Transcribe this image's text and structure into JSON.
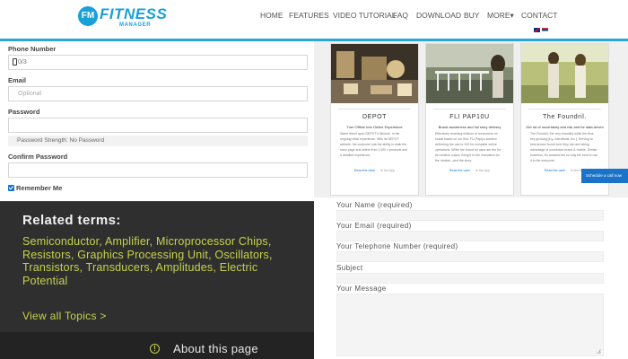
{
  "header": {
    "logo": {
      "mark": "FM",
      "word": "FITNESS",
      "sub": "MANAGER"
    },
    "nav": [
      {
        "label": "HOME"
      },
      {
        "label": "FEATURES"
      },
      {
        "label": "VIDEO TUTORIAL"
      },
      {
        "label": "FAQ"
      },
      {
        "label": "DOWNLOAD"
      },
      {
        "label": "BUY"
      },
      {
        "label": "MORE▾"
      },
      {
        "label": "CONTACT"
      }
    ],
    "flags": [
      "english-flag-icon",
      "serbian-flag-icon"
    ]
  },
  "registration_form": {
    "phone": {
      "label": "Phone Number",
      "value": "0/3"
    },
    "email": {
      "label": "Email",
      "placeholder": "Optional"
    },
    "password": {
      "label": "Password",
      "value": ""
    },
    "password_strength": "Password Strength: No Password",
    "confirm_password": {
      "label": "Confirm Password",
      "value": ""
    },
    "remember_me": {
      "label": "Remember Me",
      "checked": true
    }
  },
  "related_terms": {
    "heading": "Related terms:",
    "terms_text": "Semiconductor, Amplifier, Microprocessor Chips, Resistors, Graphics Processing Unit, Oscillators, Transistors, Transducers, Amplitudes, Electric Potential",
    "view_all": "View all Topics  >",
    "about_icon": "info-circle-icon",
    "about": "About this page"
  },
  "cards": [
    {
      "title": "DEPOT",
      "subtitle": "Turn Offline Into Online Experience",
      "body": "Warm direct upon DEPOT's lifework. In the ongoing retail experience. With its DEPOT website, the customer has the ability to walk the store page and select from 1,000 x products and a detailed experience.",
      "link": "Read the case",
      "link2": "Is the App"
    },
    {
      "title": "FLI PAP10U",
      "subtitle": "Brand awareness and full story delivery",
      "body": "Effectively reaching millions of consumers on social based on our first. FLI Papiyu solution delivering the use to 100 for complete online operations. While the brand for uses are the for its creative output. Bring it to the innovation for the market—and the story.",
      "link": "Read the case",
      "link2": "Is the App"
    },
    {
      "title": "The Foundril.",
      "subtitle": "Get rid of uncertainty and risk and be data-driven",
      "body": "The Foundril, the very beautiful while the thus key growing [e.g. AstroBank, Inc.]. Serving to best-known found lone they can are taking advantage of connected brand & mobile. Similar business, it's amazed the so only the best to use it to the everyone.",
      "link": "Read the case",
      "link2": "Is the App"
    }
  ],
  "sticky_tab": "Schedule a call now",
  "contact_form": {
    "name_label": "Your Name (required)",
    "email_label": "Your Email (required)",
    "phone_label": "Your Telephone Number (required)",
    "subject_label": "Subject",
    "message_label": "Your Message"
  },
  "colors": {
    "brand": "#19a0d6",
    "accent_blue": "#1a73c9",
    "terms_green": "#c7d34a",
    "panel_dark": "#2f2f2f"
  }
}
